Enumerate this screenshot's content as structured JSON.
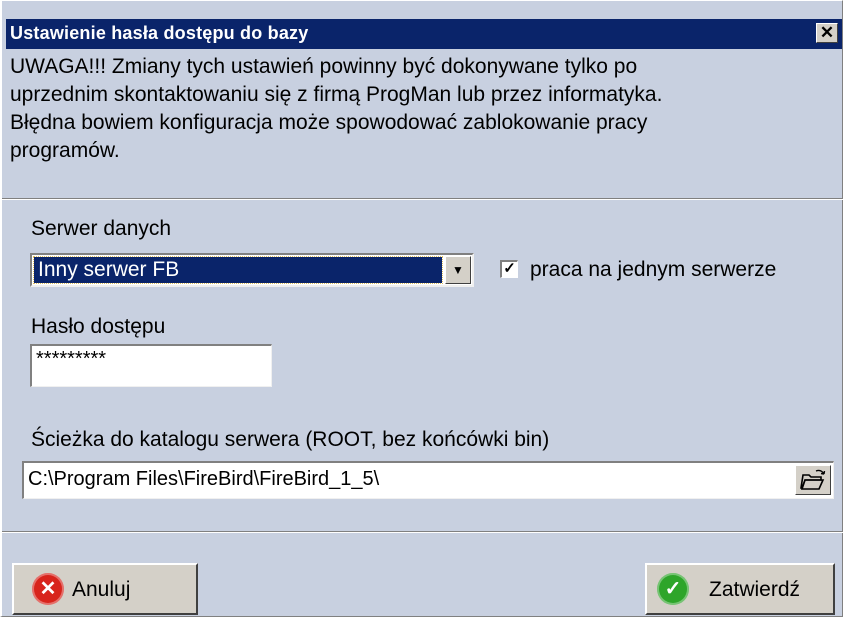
{
  "window": {
    "title": "Ustawienie hasła dostępu do bazy",
    "close_symbol": "✕"
  },
  "warning": {
    "lines": [
      "UWAGA!!! Zmiany tych ustawień powinny być dokonywane tylko po",
      "uprzednim skontaktowaniu się z firmą ProgMan lub przez informatyka.",
      "Błędna bowiem konfiguracja może spowodować zablokowanie pracy",
      "programów."
    ]
  },
  "server": {
    "label": "Serwer danych",
    "selected": "Inny serwer FB",
    "single_server_checkbox": {
      "label": "praca na jednym serwerze",
      "checked": true
    }
  },
  "password": {
    "label": "Hasło dostępu",
    "value": "*********"
  },
  "path": {
    "label": "Ścieżka do katalogu serwera (ROOT, bez końcówki bin)",
    "value": "C:\\Program Files\\FireBird\\FireBird_1_5\\",
    "browse_icon": "folder-open-icon"
  },
  "buttons": {
    "cancel": {
      "label": "Anuluj",
      "icon": "cancel-x-icon",
      "color": "#d8241c"
    },
    "confirm": {
      "label": "Zatwierdź",
      "icon": "check-icon",
      "color": "#2ea52a"
    }
  },
  "colors": {
    "titlebar": "#0a246a",
    "background": "#c8d0e0"
  }
}
